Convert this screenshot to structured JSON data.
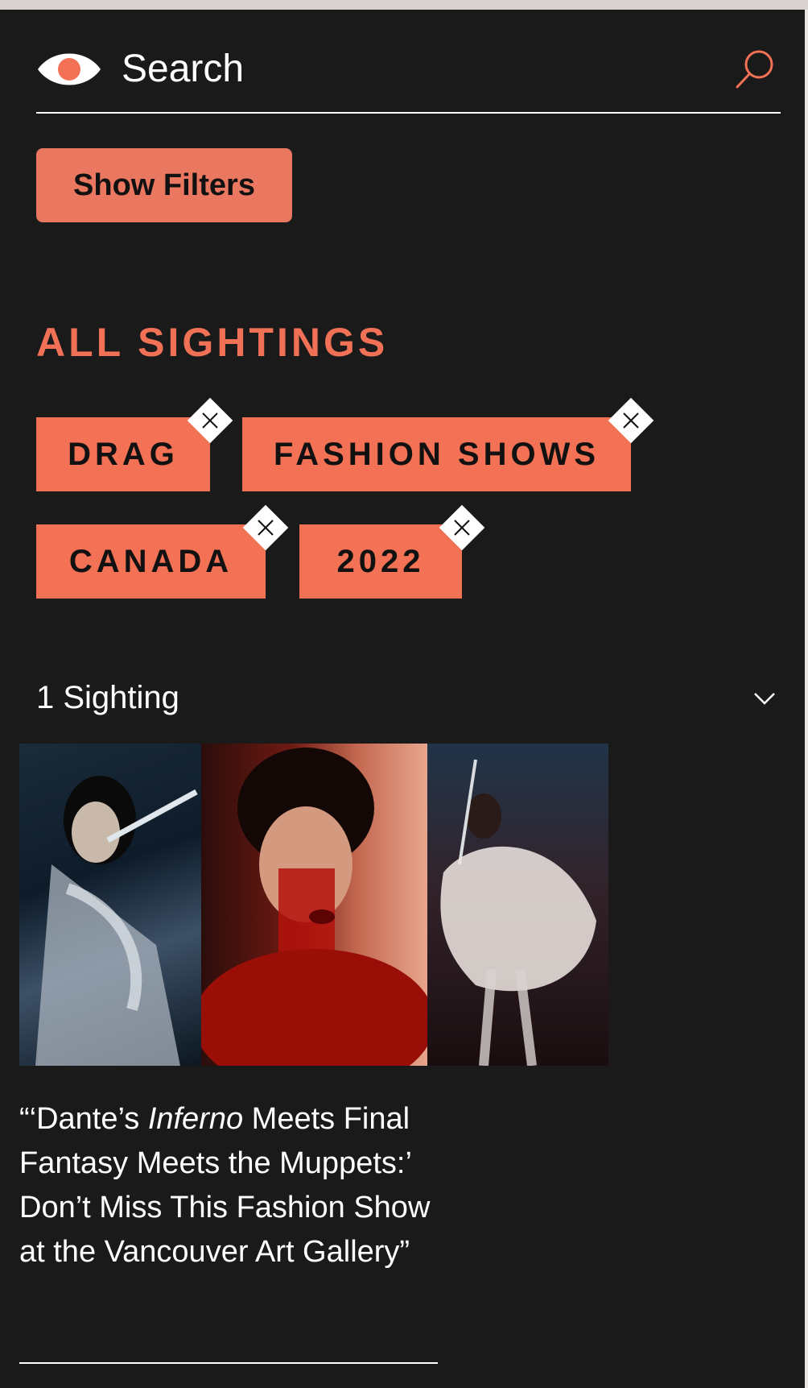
{
  "search": {
    "placeholder": "Search"
  },
  "filters": {
    "button_label": "Show Filters"
  },
  "section": {
    "title": "ALL SIGHTINGS"
  },
  "tags": [
    {
      "label": "DRAG"
    },
    {
      "label": "FASHION SHOWS"
    },
    {
      "label": "CANADA"
    },
    {
      "label": "2022"
    }
  ],
  "results": {
    "count_label": "1 Sighting"
  },
  "article": {
    "title_pre": "“‘Dante’s ",
    "title_italic": "Inferno",
    "title_post": " Meets Final Fantasy Meets the Muppets:’ Don’t Miss This Fashion Show at the Vancouver Art Gallery”"
  },
  "colors": {
    "accent": "#f37155",
    "background": "#1a1a1a",
    "text": "#ffffff"
  },
  "icons": {
    "logo": "eye-icon",
    "search": "search-icon",
    "close": "close-icon",
    "expand": "chevron-down-icon"
  }
}
